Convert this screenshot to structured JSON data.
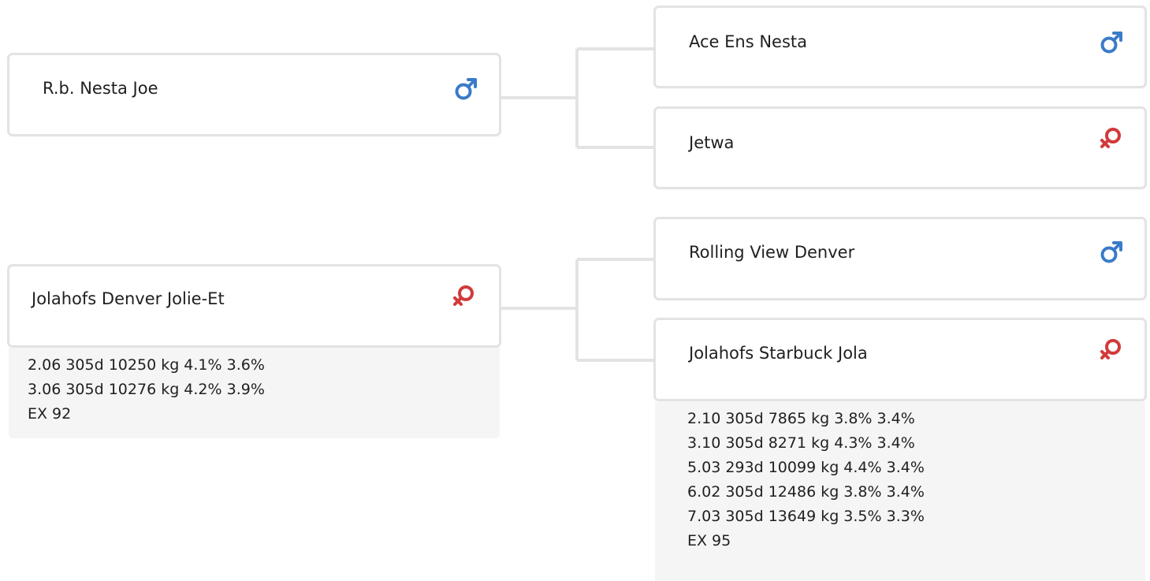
{
  "nodes": {
    "sire": {
      "name": "R.b. Nesta Joe",
      "sex": "male-icon"
    },
    "dam": {
      "name": "Jolahofs Denver Jolie-Et",
      "sex": "female-icon",
      "records": [
        "2.06 305d 10250 kg 4.1% 3.6%",
        "3.06 305d 10276 kg 4.2% 3.9%",
        "EX 92"
      ]
    },
    "sire_sire": {
      "name": "Ace Ens Nesta",
      "sex": "male-icon"
    },
    "sire_dam": {
      "name": "Jetwa",
      "sex": "female-icon"
    },
    "dam_sire": {
      "name": "Rolling View Denver",
      "sex": "male-icon"
    },
    "dam_dam": {
      "name": "Jolahofs Starbuck Jola",
      "sex": "female-icon",
      "records": [
        "2.10 305d 7865 kg 3.8% 3.4%",
        "3.10 305d 8271 kg 4.3% 3.4%",
        "5.03 293d 10099 kg 4.4% 3.4%",
        "6.02 305d 12486 kg 3.8% 3.4%",
        "7.03 305d 13649 kg 3.5% 3.3%",
        "EX 95"
      ]
    }
  },
  "colors": {
    "male": "#3a7bc8",
    "female": "#d23a3a",
    "connector": "#e3e3e3",
    "border": "#e3e3e3",
    "record_bg": "#f5f5f5"
  }
}
